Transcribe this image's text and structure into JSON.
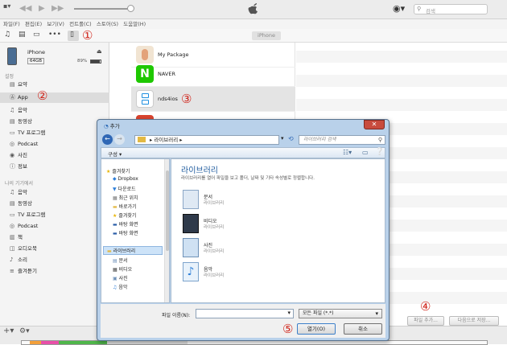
{
  "menu": [
    "파일(F)",
    "편집(E)",
    "보기(V)",
    "컨트롤(C)",
    "스토어(S)",
    "도움말(H)"
  ],
  "search": {
    "placeholder": "검색"
  },
  "toolbar": {
    "device_tab": "iPhone"
  },
  "device": {
    "name": "iPhone",
    "capacity": "64GB",
    "battery": "89%"
  },
  "sidebar": {
    "settings_header": "설정",
    "settings": [
      {
        "label": "요약",
        "icon": "summary-icon"
      },
      {
        "label": "App",
        "icon": "apps-icon"
      },
      {
        "label": "음악",
        "icon": "music-icon"
      },
      {
        "label": "동영상",
        "icon": "movie-icon"
      },
      {
        "label": "TV 프로그램",
        "icon": "tv-icon"
      },
      {
        "label": "Podcast",
        "icon": "podcast-icon"
      },
      {
        "label": "사진",
        "icon": "camera-icon"
      },
      {
        "label": "정보",
        "icon": "info-icon"
      }
    ],
    "ondevice_header": "나의 기기에서",
    "ondevice": [
      {
        "label": "음악",
        "icon": "music-icon"
      },
      {
        "label": "동영상",
        "icon": "movie-icon"
      },
      {
        "label": "TV 프로그램",
        "icon": "tv-icon"
      },
      {
        "label": "Podcast",
        "icon": "podcast-icon"
      },
      {
        "label": "책",
        "icon": "book-icon"
      },
      {
        "label": "오디오북",
        "icon": "audiobook-icon"
      },
      {
        "label": "소리",
        "icon": "bell-icon"
      },
      {
        "label": "즐겨듣기",
        "icon": "playlist-icon"
      }
    ]
  },
  "apps": [
    {
      "name": "My Package",
      "icon": "package-icon"
    },
    {
      "name": "NAVER",
      "icon": "naver-icon",
      "glyph": "N"
    },
    {
      "name": "nds4ios",
      "icon": "nds-icon"
    }
  ],
  "bottom": {
    "add_file": "파일 추가...",
    "save_to": "다음으로 저장..."
  },
  "dialog": {
    "title": "추가",
    "address": "▸ 라이브러리 ▸",
    "search_placeholder": "라이브러리 검색",
    "organize": "구성 ▾",
    "nav": {
      "favorites": "즐겨찾기",
      "favorite_items": [
        "Dropbox",
        "다운로드",
        "최근 위치",
        "바로가기",
        "즐겨찾기",
        "바탕 화면",
        "바탕 화면"
      ],
      "libraries": "라이브러리",
      "library_items": [
        "문서",
        "비디오",
        "사진",
        "음악"
      ]
    },
    "heading": "라이브러리",
    "description": "라이브러리를 열어 파일을 보고 폴더, 날짜 및 기타 속성별로 정렬합니다.",
    "libraries": [
      {
        "name": "문서",
        "sub": "라이브러리",
        "icon": "documents-library-icon"
      },
      {
        "name": "비디오",
        "sub": "라이브러리",
        "icon": "videos-library-icon"
      },
      {
        "name": "사진",
        "sub": "라이브러리",
        "icon": "pictures-library-icon"
      },
      {
        "name": "음악",
        "sub": "라이브러리",
        "icon": "music-library-icon"
      }
    ],
    "filename_label": "파일 이름(N):",
    "filetype": "모든 파일 (*.*)",
    "open": "열기(O)",
    "cancel": "취소"
  },
  "annotations": [
    "①",
    "②",
    "③",
    "④",
    "⑤"
  ],
  "colors": {
    "annotation": "#d0261c",
    "naver": "#1ec800",
    "nds": "#1d8ee0"
  }
}
